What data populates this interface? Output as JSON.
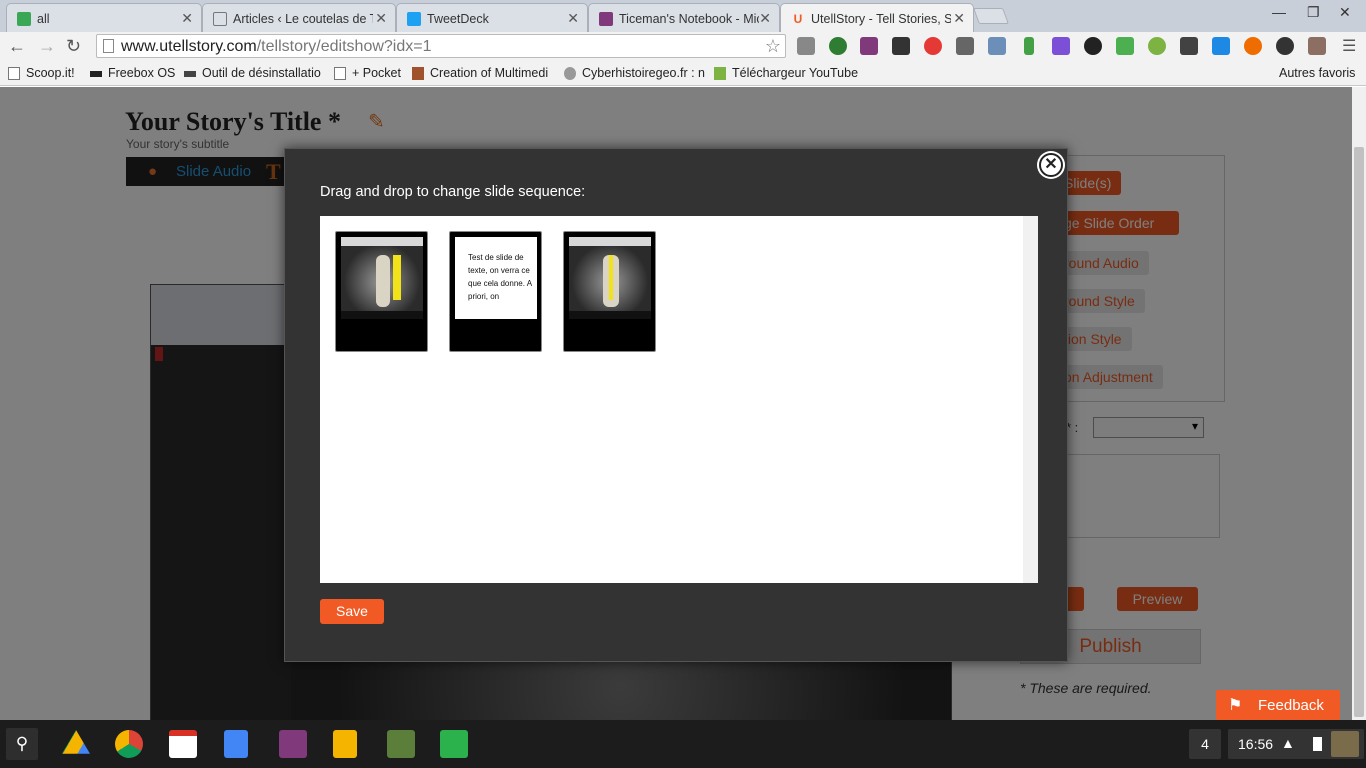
{
  "browser": {
    "tabs": [
      {
        "title": "all",
        "close": "✕"
      },
      {
        "title": "Articles ‹ Le coutelas de Ti",
        "close": "✕"
      },
      {
        "title": "TweetDeck",
        "close": "✕"
      },
      {
        "title": "Ticeman's Notebook - Mic",
        "close": "✕"
      },
      {
        "title": "UtellStory - Tell Stories, Sh",
        "close": "✕"
      }
    ],
    "url_domain": "www.utellstory.com",
    "url_path": "/tellstory/editshow?idx=1",
    "bookmarks": [
      "Scoop.it!",
      "Freebox OS",
      "Outil de désinstallatio",
      "+ Pocket",
      "Creation of Multimedi",
      "Cyberhistoiregeo.fr : n",
      "Téléchargeur YouTube"
    ],
    "other_bookmarks": "Autres favoris"
  },
  "page": {
    "story_title": "Your Story's Title *",
    "story_subtitle": "Your story's subtitle",
    "slide_audio": "Slide Audio",
    "text_icon_glyph": "T",
    "buttons": {
      "add_slides": "Slide(s)",
      "change_order": "ge Slide Order",
      "bg_audio": "round Audio",
      "bg_style": "round Style",
      "caption_style": "tion Style",
      "caption_adjust": "on Adjustment",
      "preview": "Preview",
      "publish": "Publish"
    },
    "select_marker": "* :",
    "required_note": "* These are required."
  },
  "modal": {
    "label": "Drag and drop to change slide sequence:",
    "close_glyph": "✕",
    "slides": [
      {
        "kind": "image"
      },
      {
        "kind": "text",
        "text": "Test de slide de texte, on verra ce que cela donne. A priori, on"
      },
      {
        "kind": "image"
      }
    ],
    "save_label": "Save"
  },
  "feedback": {
    "label": "Feedback"
  },
  "taskbar": {
    "window_count": "4",
    "time": "16:56"
  },
  "colors": {
    "accent": "#f15a24",
    "modal_bg": "#333333",
    "taskbar_bg": "#1c1c1c"
  }
}
